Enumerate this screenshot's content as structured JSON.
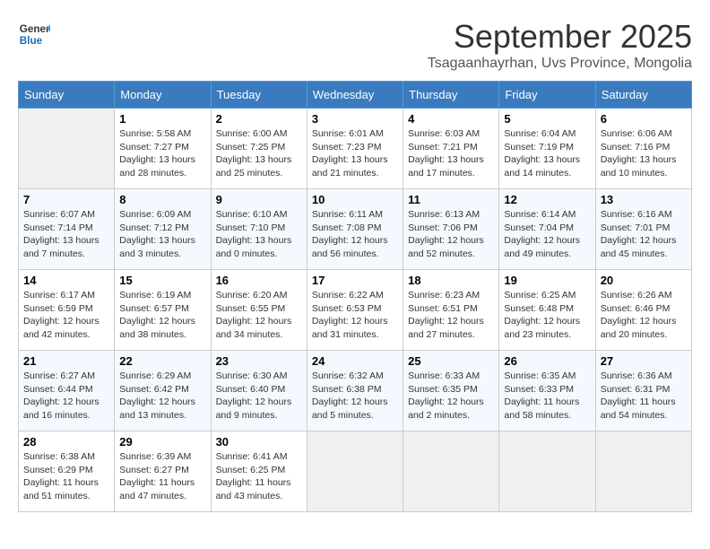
{
  "header": {
    "logo_line1": "General",
    "logo_line2": "Blue",
    "month_title": "September 2025",
    "subtitle": "Tsagaanhayrhan, Uvs Province, Mongolia"
  },
  "calendar": {
    "days_of_week": [
      "Sunday",
      "Monday",
      "Tuesday",
      "Wednesday",
      "Thursday",
      "Friday",
      "Saturday"
    ],
    "weeks": [
      [
        {
          "day": "",
          "info": ""
        },
        {
          "day": "1",
          "info": "Sunrise: 5:58 AM\nSunset: 7:27 PM\nDaylight: 13 hours\nand 28 minutes."
        },
        {
          "day": "2",
          "info": "Sunrise: 6:00 AM\nSunset: 7:25 PM\nDaylight: 13 hours\nand 25 minutes."
        },
        {
          "day": "3",
          "info": "Sunrise: 6:01 AM\nSunset: 7:23 PM\nDaylight: 13 hours\nand 21 minutes."
        },
        {
          "day": "4",
          "info": "Sunrise: 6:03 AM\nSunset: 7:21 PM\nDaylight: 13 hours\nand 17 minutes."
        },
        {
          "day": "5",
          "info": "Sunrise: 6:04 AM\nSunset: 7:19 PM\nDaylight: 13 hours\nand 14 minutes."
        },
        {
          "day": "6",
          "info": "Sunrise: 6:06 AM\nSunset: 7:16 PM\nDaylight: 13 hours\nand 10 minutes."
        }
      ],
      [
        {
          "day": "7",
          "info": "Sunrise: 6:07 AM\nSunset: 7:14 PM\nDaylight: 13 hours\nand 7 minutes."
        },
        {
          "day": "8",
          "info": "Sunrise: 6:09 AM\nSunset: 7:12 PM\nDaylight: 13 hours\nand 3 minutes."
        },
        {
          "day": "9",
          "info": "Sunrise: 6:10 AM\nSunset: 7:10 PM\nDaylight: 13 hours\nand 0 minutes."
        },
        {
          "day": "10",
          "info": "Sunrise: 6:11 AM\nSunset: 7:08 PM\nDaylight: 12 hours\nand 56 minutes."
        },
        {
          "day": "11",
          "info": "Sunrise: 6:13 AM\nSunset: 7:06 PM\nDaylight: 12 hours\nand 52 minutes."
        },
        {
          "day": "12",
          "info": "Sunrise: 6:14 AM\nSunset: 7:04 PM\nDaylight: 12 hours\nand 49 minutes."
        },
        {
          "day": "13",
          "info": "Sunrise: 6:16 AM\nSunset: 7:01 PM\nDaylight: 12 hours\nand 45 minutes."
        }
      ],
      [
        {
          "day": "14",
          "info": "Sunrise: 6:17 AM\nSunset: 6:59 PM\nDaylight: 12 hours\nand 42 minutes."
        },
        {
          "day": "15",
          "info": "Sunrise: 6:19 AM\nSunset: 6:57 PM\nDaylight: 12 hours\nand 38 minutes."
        },
        {
          "day": "16",
          "info": "Sunrise: 6:20 AM\nSunset: 6:55 PM\nDaylight: 12 hours\nand 34 minutes."
        },
        {
          "day": "17",
          "info": "Sunrise: 6:22 AM\nSunset: 6:53 PM\nDaylight: 12 hours\nand 31 minutes."
        },
        {
          "day": "18",
          "info": "Sunrise: 6:23 AM\nSunset: 6:51 PM\nDaylight: 12 hours\nand 27 minutes."
        },
        {
          "day": "19",
          "info": "Sunrise: 6:25 AM\nSunset: 6:48 PM\nDaylight: 12 hours\nand 23 minutes."
        },
        {
          "day": "20",
          "info": "Sunrise: 6:26 AM\nSunset: 6:46 PM\nDaylight: 12 hours\nand 20 minutes."
        }
      ],
      [
        {
          "day": "21",
          "info": "Sunrise: 6:27 AM\nSunset: 6:44 PM\nDaylight: 12 hours\nand 16 minutes."
        },
        {
          "day": "22",
          "info": "Sunrise: 6:29 AM\nSunset: 6:42 PM\nDaylight: 12 hours\nand 13 minutes."
        },
        {
          "day": "23",
          "info": "Sunrise: 6:30 AM\nSunset: 6:40 PM\nDaylight: 12 hours\nand 9 minutes."
        },
        {
          "day": "24",
          "info": "Sunrise: 6:32 AM\nSunset: 6:38 PM\nDaylight: 12 hours\nand 5 minutes."
        },
        {
          "day": "25",
          "info": "Sunrise: 6:33 AM\nSunset: 6:35 PM\nDaylight: 12 hours\nand 2 minutes."
        },
        {
          "day": "26",
          "info": "Sunrise: 6:35 AM\nSunset: 6:33 PM\nDaylight: 11 hours\nand 58 minutes."
        },
        {
          "day": "27",
          "info": "Sunrise: 6:36 AM\nSunset: 6:31 PM\nDaylight: 11 hours\nand 54 minutes."
        }
      ],
      [
        {
          "day": "28",
          "info": "Sunrise: 6:38 AM\nSunset: 6:29 PM\nDaylight: 11 hours\nand 51 minutes."
        },
        {
          "day": "29",
          "info": "Sunrise: 6:39 AM\nSunset: 6:27 PM\nDaylight: 11 hours\nand 47 minutes."
        },
        {
          "day": "30",
          "info": "Sunrise: 6:41 AM\nSunset: 6:25 PM\nDaylight: 11 hours\nand 43 minutes."
        },
        {
          "day": "",
          "info": ""
        },
        {
          "day": "",
          "info": ""
        },
        {
          "day": "",
          "info": ""
        },
        {
          "day": "",
          "info": ""
        }
      ]
    ]
  }
}
